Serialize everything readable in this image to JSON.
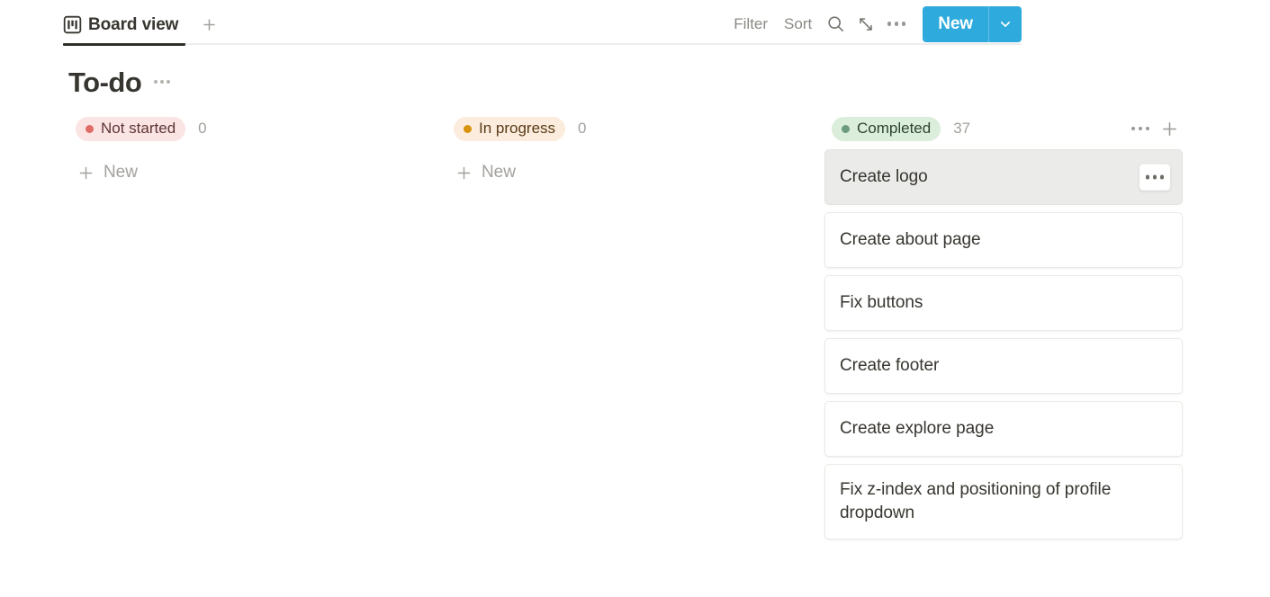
{
  "view_header": {
    "tabs": [
      {
        "label": "Board view",
        "icon": "board-view-icon",
        "active": true
      }
    ],
    "add_view_icon": "plus-icon",
    "toolbar": {
      "filter_label": "Filter",
      "sort_label": "Sort",
      "search_icon": "search-icon",
      "expand_icon": "expand-diagonal-arrows-icon",
      "more_icon": "ellipsis-icon",
      "new_label": "New",
      "new_caret_icon": "chevron-down-icon",
      "new_button_color": "#2eaadc"
    }
  },
  "database": {
    "title": "To-do",
    "title_menu_icon": "ellipsis-icon"
  },
  "board": {
    "new_row_label": "New",
    "new_row_icon": "plus-icon",
    "columns": [
      {
        "status": "Not started",
        "count": "0",
        "pill_bg": "#fbe4e4",
        "pill_text": "#5d3534",
        "dot_color": "#e06b67",
        "show_actions": false,
        "show_new_row": true,
        "cards": []
      },
      {
        "status": "In progress",
        "count": "0",
        "pill_bg": "#fbecdd",
        "pill_text": "#5a3a16",
        "dot_color": "#d9930d",
        "show_actions": false,
        "show_new_row": true,
        "cards": []
      },
      {
        "status": "Completed",
        "count": "37",
        "pill_bg": "#dbeddb",
        "pill_text": "#2b4430",
        "dot_color": "#6c9b7d",
        "show_actions": true,
        "more_icon": "ellipsis-icon",
        "add_icon": "plus-icon",
        "show_new_row": false,
        "cards": [
          {
            "title": "Create logo",
            "hovered": true,
            "menu_icon": "ellipsis-icon"
          },
          {
            "title": "Create about page",
            "hovered": false
          },
          {
            "title": "Fix buttons",
            "hovered": false
          },
          {
            "title": "Create footer",
            "hovered": false
          },
          {
            "title": "Create explore page",
            "hovered": false
          },
          {
            "title": "Fix z-index and positioning of profile dropdown",
            "hovered": false
          }
        ]
      }
    ]
  }
}
